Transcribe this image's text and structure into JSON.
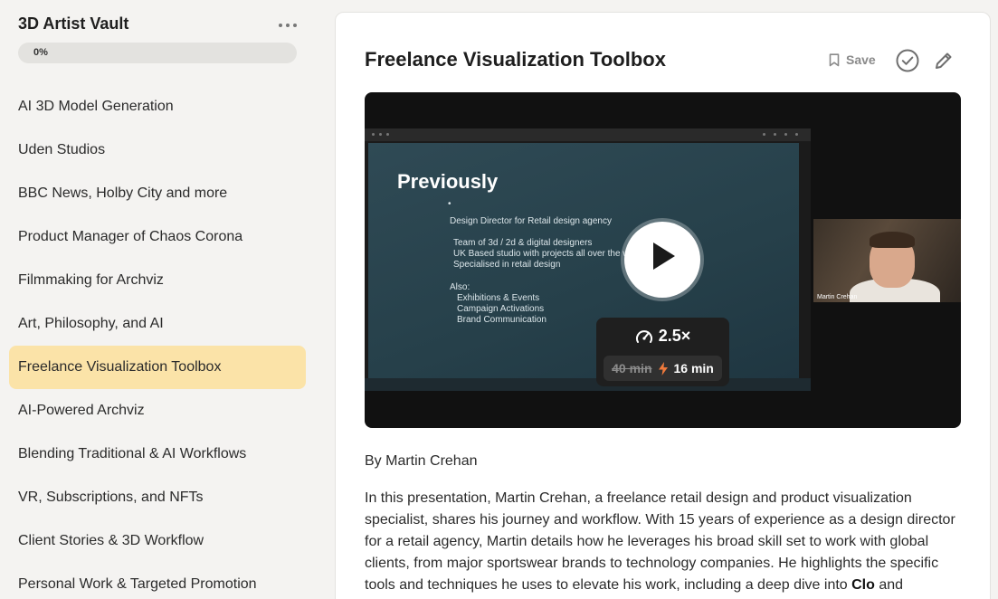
{
  "sidebar": {
    "title": "3D Artist Vault",
    "progress_label": "0%",
    "progress_value": 0,
    "items": [
      {
        "label": "AI 3D Model Generation"
      },
      {
        "label": "Uden Studios"
      },
      {
        "label": "BBC News, Holby City and more"
      },
      {
        "label": "Product Manager of Chaos Corona"
      },
      {
        "label": "Filmmaking for Archviz"
      },
      {
        "label": "Art, Philosophy, and AI"
      },
      {
        "label": "Freelance Visualization Toolbox",
        "active": true
      },
      {
        "label": "AI-Powered Archviz"
      },
      {
        "label": "Blending Traditional & AI Workflows"
      },
      {
        "label": "VR, Subscriptions, and NFTs"
      },
      {
        "label": "Client Stories & 3D Workflow"
      },
      {
        "label": "Personal Work & Targeted Promotion"
      }
    ]
  },
  "main": {
    "title": "Freelance Visualization Toolbox",
    "save_label": "Save",
    "video": {
      "slide_heading": "Previously",
      "slide_bullet": "•",
      "slide_role": "Design Director for Retail design agency",
      "slide_line1": "Team of 3d / 2d & digital designers",
      "slide_line2": "UK Based studio with projects all over the w",
      "slide_line3": "Specialised in retail design",
      "slide_also": "Also:",
      "slide_also1": "Exhibitions & Events",
      "slide_also2": "Campaign Activations",
      "slide_also3": "Brand Communication",
      "webcam_name": "Martin Crehan",
      "speed": "2.5×",
      "original_time": "40 min",
      "new_time": "16 min"
    },
    "author": "By Martin Crehan",
    "description_part1": "In this presentation, Martin Crehan, a freelance retail design and product visualization specialist, shares his journey and workflow. With 15 years of experience as a design director for a retail agency, Martin details how he leverages his broad skill set to work with global clients, from major sportswear brands to technology companies. He highlights the specific tools and techniques he uses to elevate his work, including a deep dive into ",
    "description_bold": "Clo",
    "description_part2": " and"
  },
  "colors": {
    "active_item": "#fbe3a8",
    "background": "#f4f3f1",
    "panel": "#ffffff"
  }
}
